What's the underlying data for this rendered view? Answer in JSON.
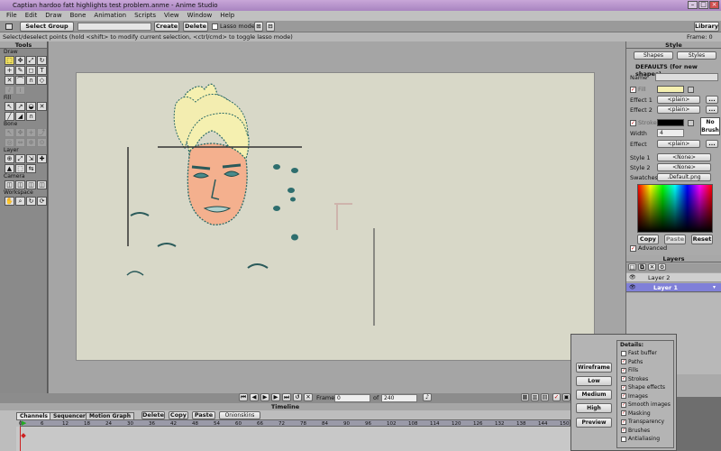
{
  "window": {
    "title": "Captian hardoo  fatt highlights test problem.anme - Anime Studio"
  },
  "menu": [
    "File",
    "Edit",
    "Draw",
    "Bone",
    "Animation",
    "Scripts",
    "View",
    "Window",
    "Help"
  ],
  "toolbar": {
    "select_group": "Select Group",
    "create": "Create",
    "delete": "Delete",
    "lasso": "Lasso mode",
    "library": "Library"
  },
  "status": {
    "hint": "Select/deselect points (hold <shift> to modify current selection, <ctrl/cmd> to toggle lasso mode)",
    "frame": "Frame: 0"
  },
  "tools": {
    "title": "Tools",
    "sections": [
      "Draw",
      "Fill",
      "Bone",
      "Layer",
      "Camera",
      "Workspace"
    ]
  },
  "style_panel": {
    "title": "Style",
    "shapes": "Shapes",
    "styles": "Styles",
    "defaults": "DEFAULTS (for new shapes)",
    "name_label": "Name",
    "fill_label": "Fill",
    "effect1": "Effect 1",
    "effect2": "Effect 2",
    "plain": "<plain>",
    "stroke_label": "Stroke",
    "width_label": "Width",
    "width_value": "4",
    "effect_label": "Effect",
    "no_brush": "No Brush",
    "style1": "Style 1",
    "style2": "Style 2",
    "none": "<None>",
    "swatches": "Swatches",
    "swatch_file": ".Default.png",
    "copy": "Copy",
    "paste": "Paste",
    "reset": "Reset",
    "advanced": "Advanced",
    "colors": {
      "fill": "#f5f0b0",
      "stroke": "#000000"
    }
  },
  "layers_panel": {
    "title": "Layers",
    "layers": [
      {
        "name": "Layer 2",
        "selected": false
      },
      {
        "name": "Layer 1",
        "selected": true
      }
    ]
  },
  "render": {
    "quality": [
      "Wireframe",
      "Low",
      "Medium",
      "High",
      "Preview"
    ],
    "details_title": "Details:",
    "details": [
      {
        "label": "Fast buffer",
        "checked": false
      },
      {
        "label": "Paths",
        "checked": true
      },
      {
        "label": "Fills",
        "checked": true
      },
      {
        "label": "Strokes",
        "checked": true
      },
      {
        "label": "Shape effects",
        "checked": true
      },
      {
        "label": "Images",
        "checked": true
      },
      {
        "label": "Smooth images",
        "checked": true
      },
      {
        "label": "Masking",
        "checked": true
      },
      {
        "label": "Transparency",
        "checked": true
      },
      {
        "label": "Brushes",
        "checked": true
      },
      {
        "label": "Antialiasing",
        "checked": false
      }
    ]
  },
  "playback": {
    "frame_label": "Frame",
    "frame_value": "0",
    "of_label": "of",
    "total_frames": "240"
  },
  "timeline": {
    "title": "Timeline",
    "tabs": [
      "Channels",
      "Sequencer",
      "Motion Graph"
    ],
    "delete": "Delete",
    "copy": "Copy",
    "paste": "Paste",
    "onionskins": "Onionskins",
    "ticks": [
      "0",
      "6",
      "12",
      "18",
      "24",
      "30",
      "36",
      "42",
      "48",
      "54",
      "60",
      "66",
      "72",
      "78",
      "84",
      "90",
      "96",
      "102",
      "108",
      "114",
      "120",
      "126",
      "132",
      "138",
      "144",
      "150",
      "156"
    ]
  }
}
